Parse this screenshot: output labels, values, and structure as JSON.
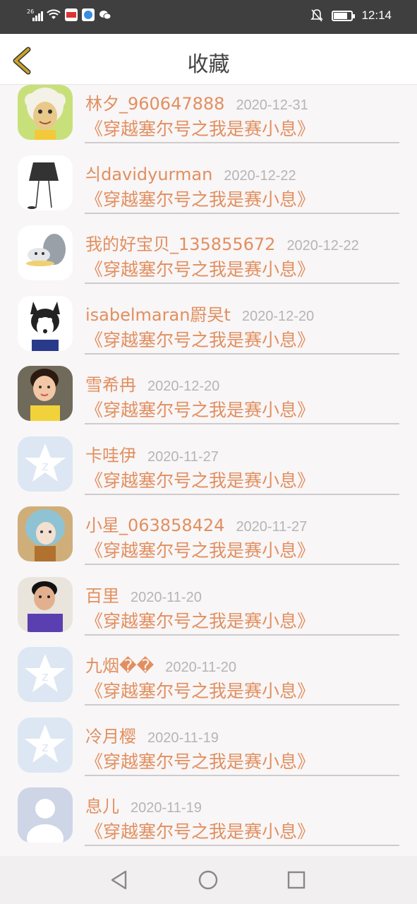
{
  "status_bar": {
    "network": "26",
    "time": "12:14",
    "app_icons": [
      "app-icon-1",
      "app-icon-2",
      "wechat-icon"
    ]
  },
  "header": {
    "title": "收藏"
  },
  "items": [
    {
      "name": "林夕_960647888",
      "date": "2020-12-31",
      "book": "《穿越塞尔号之我是赛小息》",
      "avatar": "sheep"
    },
    {
      "name": "싀davidyurman",
      "date": "2020-12-22",
      "book": "《穿越塞尔号之我是赛小息》",
      "avatar": "sketch"
    },
    {
      "name": "我的好宝贝_135855672",
      "date": "2020-12-22",
      "book": "《穿越塞尔号之我是赛小息》",
      "avatar": "animal"
    },
    {
      "name": "isabelmaran罻旲t",
      "date": "2020-12-20",
      "book": "《穿越塞尔号之我是赛小息》",
      "avatar": "husky"
    },
    {
      "name": "雪希冉",
      "date": "2020-12-20",
      "book": "《穿越塞尔号之我是赛小息》",
      "avatar": "child"
    },
    {
      "name": "卡哇伊",
      "date": "2020-11-27",
      "book": "《穿越塞尔号之我是赛小息》",
      "avatar": "qq"
    },
    {
      "name": "小星_063858424",
      "date": "2020-11-27",
      "book": "《穿越塞尔号之我是赛小息》",
      "avatar": "anime"
    },
    {
      "name": "百里",
      "date": "2020-11-20",
      "book": "《穿越塞尔号之我是赛小息》",
      "avatar": "person"
    },
    {
      "name": "九烟��",
      "date": "2020-11-20",
      "book": "《穿越塞尔号之我是赛小息》",
      "avatar": "qq"
    },
    {
      "name": "冷月樱",
      "date": "2020-11-19",
      "book": "《穿越塞尔号之我是赛小息》",
      "avatar": "qq"
    },
    {
      "name": "息儿",
      "date": "2020-11-19",
      "book": "《穿越塞尔号之我是赛小息》",
      "avatar": "silhouette"
    }
  ],
  "colors": {
    "accent": "#e28f5f",
    "date_text": "#b8b4b6",
    "back_arrow": "#c9a32a"
  }
}
